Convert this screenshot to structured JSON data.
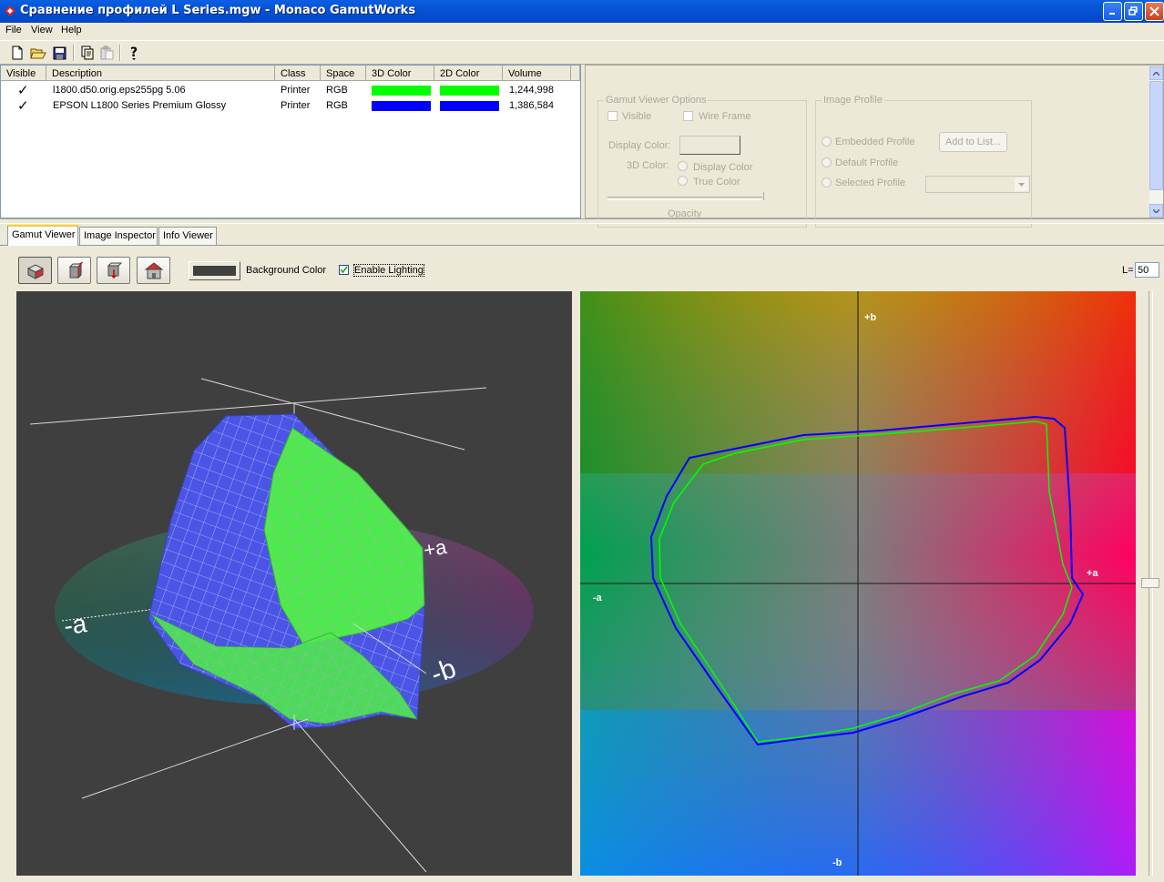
{
  "window": {
    "title": "Сравнение профилей L Series.mgw - Monaco GamutWorks",
    "controls": [
      "minimize",
      "restore",
      "close"
    ]
  },
  "menu": {
    "file": "File",
    "view": "View",
    "help": "Help"
  },
  "toolbar": {
    "icons": [
      "new-icon",
      "open-icon",
      "save-icon",
      "copy-icon",
      "paste-icon",
      "help-icon"
    ]
  },
  "profiles": {
    "columns": {
      "visible": "Visible",
      "description": "Description",
      "class": "Class",
      "space": "Space",
      "color3d": "3D Color",
      "color2d": "2D Color",
      "volume": "Volume"
    },
    "rows": [
      {
        "visible": "✓",
        "description": "l1800.d50.orig.eps255pg 5.06",
        "class": "Printer",
        "space": "RGB",
        "color3d": "#00ff00",
        "color2d": "#00ff00",
        "volume": "1,244,998"
      },
      {
        "visible": "✓",
        "description": "EPSON L1800 Series Premium Glossy",
        "class": "Printer",
        "space": "RGB",
        "color3d": "#0000ff",
        "color2d": "#0000ff",
        "volume": "1,386,584"
      }
    ]
  },
  "gamut_options": {
    "title": "Gamut Viewer Options",
    "visible": "Visible",
    "wire_frame": "Wire Frame",
    "display_color_label": "Display Color:",
    "color3d_label": "3D Color:",
    "display_color_option": "Display Color",
    "true_color_option": "True Color",
    "opacity": "Opacity"
  },
  "image_profile": {
    "title": "Image Profile",
    "embedded": "Embedded Profile",
    "default": "Default Profile",
    "selected": "Selected Profile",
    "add_to_list": "Add to List..."
  },
  "tabs": {
    "gamut_viewer": "Gamut Viewer",
    "image_inspector": "Image Inspector",
    "info_viewer": "Info Viewer"
  },
  "viewer": {
    "background_color_label": "Background Color",
    "background_color": "#404040",
    "enable_lighting": "Enable Lighting",
    "enable_lighting_checked": true,
    "l_label": "L=",
    "l_value": "50"
  },
  "view3d": {
    "axis_minus_a": "-a",
    "axis_plus_a": "+a",
    "axis_minus_b": "-b"
  },
  "view2d": {
    "plus_b": "+b",
    "minus_b": "-b",
    "plus_a": "+a",
    "minus_a": "-a"
  }
}
